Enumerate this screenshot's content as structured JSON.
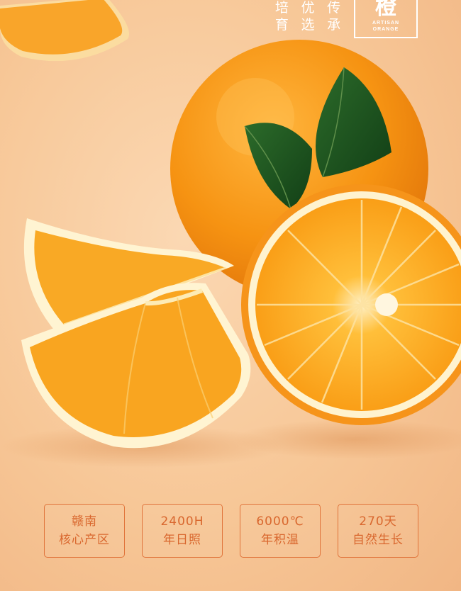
{
  "slogan": [
    "培",
    "优",
    "传",
    "育",
    "选",
    "承"
  ],
  "logo": {
    "glyph": "橙",
    "line1": "ARTISAN",
    "line2": "ORANGE"
  },
  "features": [
    {
      "line1": "赣南",
      "line2": "核心产区"
    },
    {
      "line1": "2400H",
      "line2": "年日照"
    },
    {
      "line1": "6000℃",
      "line2": "年积温"
    },
    {
      "line1": "270天",
      "line2": "自然生长"
    }
  ],
  "colors": {
    "background": "#f7c797",
    "accent": "#e0733a",
    "orange": "#f59a1b"
  }
}
